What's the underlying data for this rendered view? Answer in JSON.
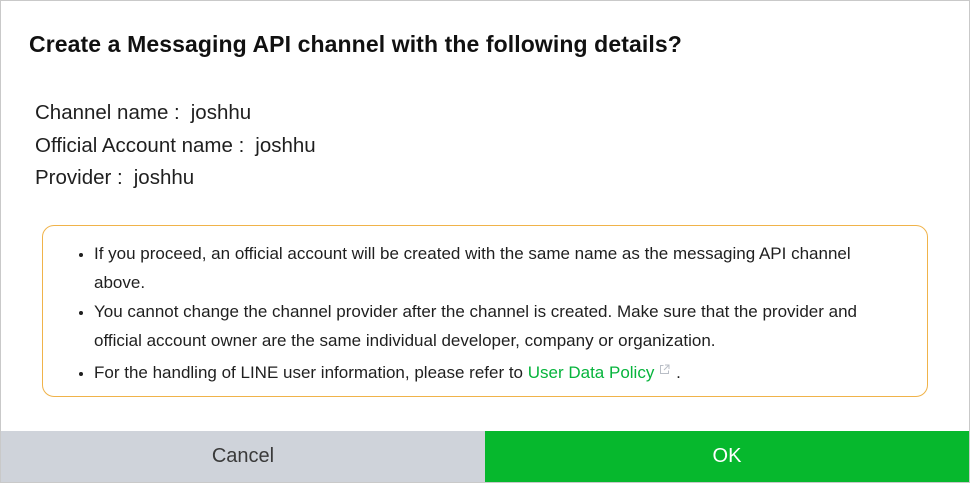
{
  "dialog": {
    "title": "Create a Messaging API channel with the following details?",
    "details": [
      {
        "label": "Channel name :",
        "value": "joshhu"
      },
      {
        "label": "Official Account name :",
        "value": "joshhu"
      },
      {
        "label": "Provider :",
        "value": "joshhu"
      }
    ],
    "notice": {
      "items": [
        "If you proceed, an official account will be created with the same name as the messaging API channel above.",
        "You cannot change the channel provider after the channel is created. Make sure that the provider and official account owner are the same individual developer, company or organization."
      ],
      "policy_prefix": "For the handling of LINE user information, please refer to ",
      "policy_link": "User Data Policy",
      "policy_suffix": " ."
    },
    "buttons": {
      "cancel": "Cancel",
      "ok": "OK"
    },
    "colors": {
      "accent_green": "#06b82d",
      "link_green": "#06b43c",
      "notice_border": "#f0b34a",
      "cancel_bg": "#cfd3da"
    },
    "icons": {
      "policy_link_icon": "external-link-icon"
    }
  }
}
